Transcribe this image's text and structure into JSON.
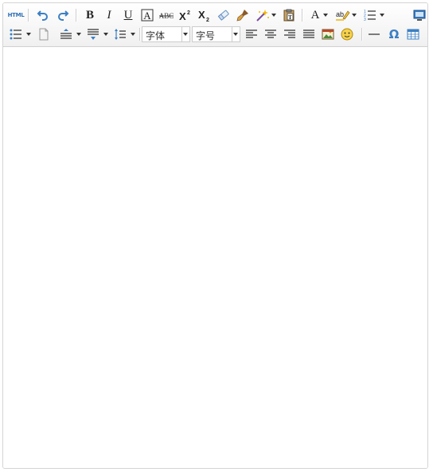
{
  "toolbar": {
    "row1": {
      "html_label": "HTML"
    },
    "row2": {
      "font_family_value": "字体",
      "font_size_value": "字号"
    }
  },
  "icons": [
    "html-source-icon",
    "undo-icon",
    "redo-icon",
    "bold-icon",
    "italic-icon",
    "underline-icon",
    "font-border-icon",
    "strikethrough-icon",
    "superscript-icon",
    "subscript-icon",
    "eraser-icon",
    "format-brush-icon",
    "auto-format-icon",
    "paste-text-icon",
    "font-color-icon",
    "highlight-color-icon",
    "ordered-list-icon",
    "preview-icon",
    "unordered-list-icon",
    "new-page-icon",
    "paragraph-spacing-top-icon",
    "paragraph-spacing-bottom-icon",
    "line-height-icon",
    "align-left-icon",
    "align-center-icon",
    "align-right-icon",
    "align-justify-icon",
    "image-icon",
    "emotion-icon",
    "horizontal-rule-icon",
    "special-chars-icon",
    "table-icon"
  ],
  "colors": {
    "icon_blue": "#3b7fc4",
    "icon_dark": "#333333",
    "border": "#d4d4d4"
  }
}
